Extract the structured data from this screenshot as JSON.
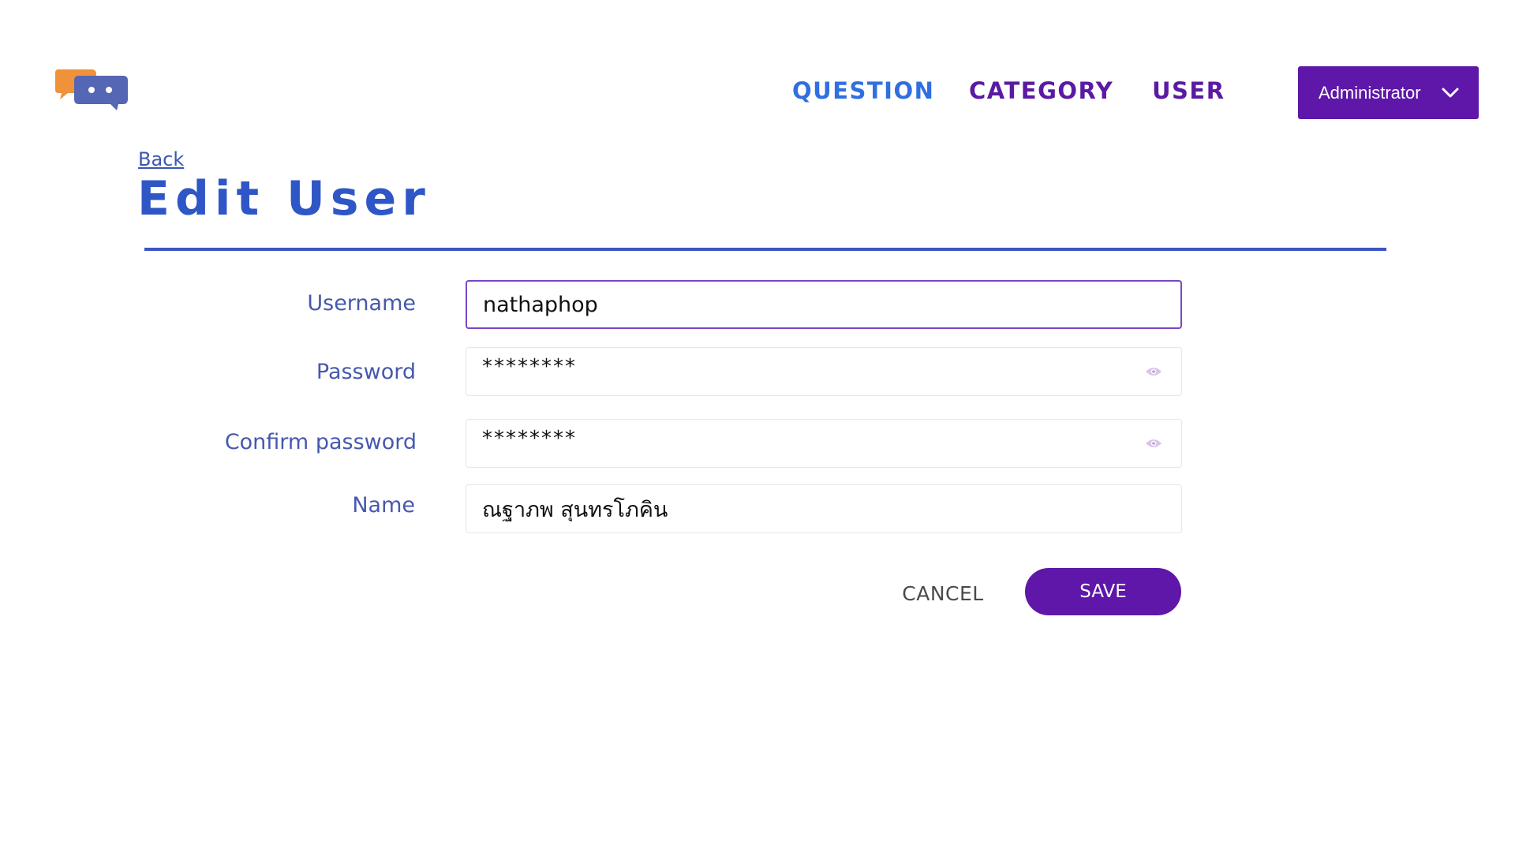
{
  "header": {
    "logo_icon": "chat-bubbles-logo",
    "nav": {
      "question": "QUESTION",
      "category": "CATEGORY",
      "user": "USER"
    },
    "account": {
      "label": "Administrator",
      "icon": "chevron-down-icon"
    }
  },
  "page": {
    "back_label": "Back",
    "title": "Edit User"
  },
  "form": {
    "username": {
      "label": "Username",
      "value": "nathaphop"
    },
    "password": {
      "label": "Password",
      "value": "********",
      "icon": "eye-icon"
    },
    "confirm_password": {
      "label": "Confirm password",
      "value": "********",
      "icon": "eye-icon"
    },
    "name": {
      "label": "Name",
      "value": "ณฐาภพ สุนทรโภคิน"
    }
  },
  "actions": {
    "cancel_label": "CANCEL",
    "save_label": "SAVE"
  },
  "colors": {
    "primary": "#5e17a8",
    "nav_active": "#2f6fe0",
    "title": "#2f56c6",
    "label": "#4658ae",
    "logo_orange": "#f0923a",
    "logo_blue": "#5466b4"
  }
}
